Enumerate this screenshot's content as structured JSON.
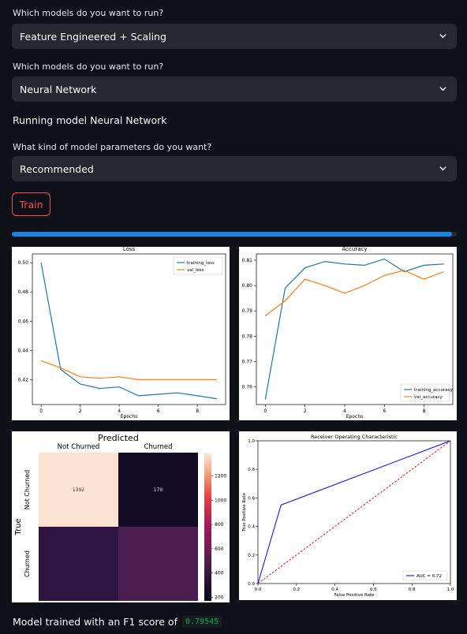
{
  "form": {
    "q1_label": "Which models do you want to run?",
    "q1_value": "Feature Engineered + Scaling",
    "q2_label": "Which models do you want to run?",
    "q2_value": "Neural Network",
    "running_text": "Running model Neural Network",
    "q3_label": "What kind of model parameters do you want?",
    "q3_value": "Recommended",
    "train_label": "Train",
    "progress_percent": 99
  },
  "result": {
    "prefix": "Model trained with an F1 score of",
    "score": "0.79545"
  },
  "colors": {
    "background": "#0e1117",
    "select_bg": "#262730",
    "accent_red": "#ff4b4b",
    "progress_blue": "#1c83e1",
    "code_green": "#09ab3b",
    "train_series": "#1f77b4",
    "val_series": "#ff7f0e"
  },
  "icons": {
    "select_chevron": "chevron-down-icon"
  },
  "chart_data": [
    {
      "type": "line",
      "title": "Loss",
      "xlabel": "Epochs",
      "ylabel": "",
      "x": [
        0,
        1,
        2,
        3,
        4,
        5,
        6,
        7,
        8,
        9
      ],
      "xticks": [
        0,
        2,
        4,
        6,
        8
      ],
      "ylim": [
        0.403,
        0.506
      ],
      "yticks": [
        0.42,
        0.44,
        0.46,
        0.48,
        0.5
      ],
      "ytick_labels": [
        "0.42",
        "0.44",
        "0.46",
        "0.48",
        "0.50"
      ],
      "legend_position": "upper right",
      "series": [
        {
          "name": "training_loss",
          "color": "#1f77b4",
          "values": [
            0.5,
            0.427,
            0.417,
            0.414,
            0.415,
            0.409,
            0.41,
            0.411,
            0.409,
            0.407
          ]
        },
        {
          "name": "val_loss",
          "color": "#ff7f0e",
          "values": [
            0.433,
            0.428,
            0.422,
            0.421,
            0.422,
            0.42,
            0.42,
            0.42,
            0.42,
            0.42
          ]
        }
      ]
    },
    {
      "type": "line",
      "title": "Accuracy",
      "xlabel": "Epochs",
      "ylabel": "",
      "x": [
        0,
        1,
        2,
        3,
        4,
        5,
        6,
        7,
        8,
        9
      ],
      "xticks": [
        0,
        2,
        4,
        6,
        8
      ],
      "ylim": [
        0.753,
        0.8125
      ],
      "yticks": [
        0.76,
        0.77,
        0.78,
        0.79,
        0.8,
        0.81
      ],
      "ytick_labels": [
        "0.76",
        "0.77",
        "0.78",
        "0.79",
        "0.80",
        "0.81"
      ],
      "legend_position": "lower right",
      "series": [
        {
          "name": "training_accuracy",
          "color": "#1f77b4",
          "values": [
            0.755,
            0.799,
            0.807,
            0.8095,
            0.8085,
            0.808,
            0.8105,
            0.8055,
            0.808,
            0.8085
          ]
        },
        {
          "name": "val_accuracy",
          "color": "#ff7f0e",
          "values": [
            0.788,
            0.794,
            0.8025,
            0.8,
            0.797,
            0.8,
            0.804,
            0.806,
            0.8025,
            0.8055
          ]
        }
      ]
    },
    {
      "type": "heatmap",
      "title": "Predicted",
      "ylabel": "True",
      "columns": [
        "Not Churned",
        "Churned"
      ],
      "rows": [
        "Not Churned",
        "Churned"
      ],
      "values": [
        [
          1392,
          179
        ],
        [
          null,
          null
        ]
      ],
      "cell_colors": [
        [
          "#fbe3d3",
          "#130b26"
        ],
        [
          "#2e1440",
          "#4b1e4f"
        ]
      ],
      "colorbar_ticks": [
        200,
        400,
        600,
        800,
        1000,
        1200
      ],
      "colorbar_range": [
        170,
        1392
      ]
    },
    {
      "type": "line",
      "title": "Receiver Operating Characteristic",
      "xlabel": "False Positive Rate",
      "ylabel": "True Positive Rate",
      "xlim": [
        0,
        1
      ],
      "ylim": [
        0,
        1
      ],
      "ticks": [
        0.0,
        0.2,
        0.4,
        0.6,
        0.8,
        1.0
      ],
      "tick_labels": [
        "0.0",
        "0.2",
        "0.4",
        "0.6",
        "0.8",
        "1.0"
      ],
      "legend_position": "lower right",
      "series": [
        {
          "name": "AUC = 0.72",
          "color": "#0000ff",
          "style": "solid",
          "points": [
            [
              0,
              0
            ],
            [
              0.12,
              0.55
            ],
            [
              1,
              1
            ]
          ]
        },
        {
          "name": "",
          "color": "#ff0000",
          "style": "dashed",
          "points": [
            [
              0,
              0
            ],
            [
              1,
              1
            ]
          ]
        }
      ]
    }
  ]
}
